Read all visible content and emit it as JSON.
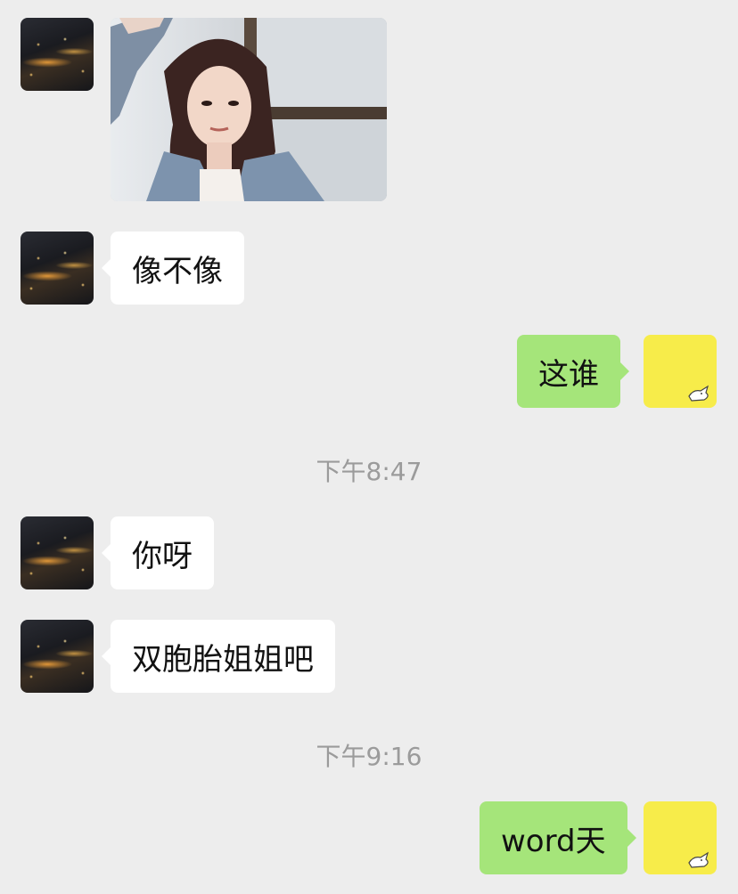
{
  "messages": [
    {
      "side": "left",
      "type": "image",
      "alt": ""
    },
    {
      "side": "left",
      "type": "text",
      "text": "像不像"
    },
    {
      "side": "right",
      "type": "text",
      "text": "这谁"
    },
    {
      "type": "time",
      "text": "下午8:47"
    },
    {
      "side": "left",
      "type": "text",
      "text": "你呀"
    },
    {
      "side": "left",
      "type": "text",
      "text": "双胞胎姐姐吧"
    },
    {
      "type": "time",
      "text": "下午9:16"
    },
    {
      "side": "right",
      "type": "text",
      "text": "word天"
    }
  ],
  "colors": {
    "background": "#ededed",
    "incoming_bubble": "#ffffff",
    "outgoing_bubble": "#a5e57a",
    "timestamp": "#9b9b9b",
    "my_avatar": "#f7ec4a"
  },
  "icons": {
    "contact_avatar": "night-city-avatar",
    "my_avatar": "yellow-doodle-avatar"
  }
}
